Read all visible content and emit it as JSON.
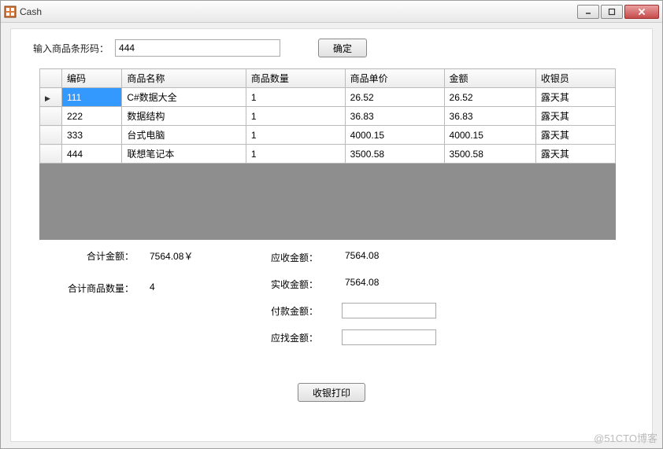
{
  "window": {
    "title": "Cash"
  },
  "input": {
    "barcode_label": "输入商品条形码：",
    "barcode_value": "444",
    "confirm_label": "确定"
  },
  "grid": {
    "headers": [
      "编码",
      "商品名称",
      "商品数量",
      "商品单价",
      "金额",
      "收银员"
    ],
    "rows": [
      {
        "code": "111",
        "name": "C#数据大全",
        "qty": "1",
        "price": "26.52",
        "amount": "26.52",
        "cashier": "露天其"
      },
      {
        "code": "222",
        "name": "数据结构",
        "qty": "1",
        "price": "36.83",
        "amount": "36.83",
        "cashier": "露天其"
      },
      {
        "code": "333",
        "name": "台式电脑",
        "qty": "1",
        "price": "4000.15",
        "amount": "4000.15",
        "cashier": "露天其"
      },
      {
        "code": "444",
        "name": "联想笔记本",
        "qty": "1",
        "price": "3500.58",
        "amount": "3500.58",
        "cashier": "露天其"
      }
    ]
  },
  "summary": {
    "total_amount_label": "合计金额：",
    "total_amount_value": "7564.08￥",
    "total_qty_label": "合计商品数量：",
    "total_qty_value": "4",
    "receivable_label": "应收金额：",
    "receivable_value": "7564.08",
    "received_label": "实收金额：",
    "received_value": "7564.08",
    "payment_label": "付款金额：",
    "payment_value": "",
    "change_label": "应找金额：",
    "change_value": ""
  },
  "print": {
    "button_label": "收银打印"
  },
  "watermark": "@51CTO博客"
}
